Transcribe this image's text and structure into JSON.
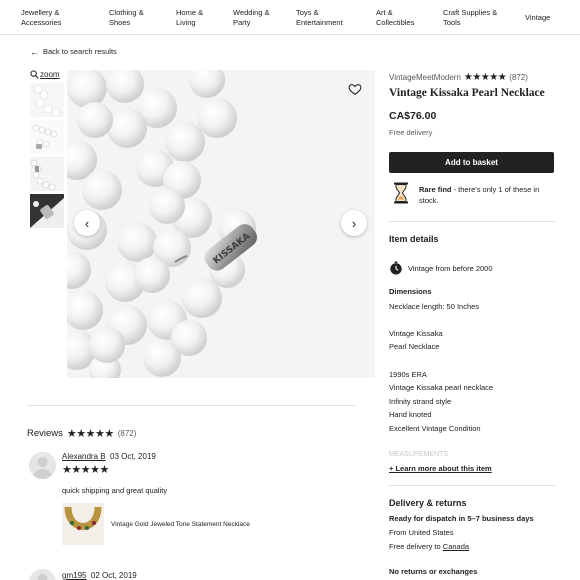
{
  "nav": {
    "categories": [
      "Jewellery & Accessories",
      "Clothing & Shoes",
      "Home & Living",
      "Wedding & Party",
      "Toys & Entertainment",
      "Art & Collectibles",
      "Craft Supplies & Tools",
      "Vintage"
    ]
  },
  "back_link": "Back to search results",
  "gallery": {
    "zoom_label": "zoom"
  },
  "product": {
    "shop_name": "VintageMeetModern",
    "shop_stars": "★★★★★",
    "shop_rating_count": "(872)",
    "title": "Vintage Kissaka Pearl Necklace",
    "price": "CA$76.00",
    "delivery": "Free delivery",
    "add_to_basket": "Add to basket",
    "rare_title": "Rare find",
    "rare_text": " - there's only 1 of these in stock."
  },
  "details": {
    "heading": "Item details",
    "vintage": "Vintage from before 2000",
    "dimensions_label": "Dimensions",
    "dimensions_value": "Necklace length: 50 Inches",
    "desc1": "Vintage Kissaka",
    "desc2": "Pearl Necklace",
    "desc3": "1990s ERA",
    "desc4": "Vintage Kissaka pearl necklace",
    "desc5": "Infinity strand style",
    "desc6": "Hand knoted",
    "desc7": "Excellent Vintage Condition",
    "desc8": "MEASUREMENTS",
    "learn_more": "+ Learn more about this item"
  },
  "delivery_section": {
    "heading": "Delivery & returns",
    "dispatch": "Ready for dispatch in 5–7 business days",
    "from": "From United States",
    "free_to_prefix": "Free delivery to ",
    "free_to_country": "Canada",
    "returns": "No returns or exchanges"
  },
  "reviews": {
    "heading": "Reviews",
    "stars": "★★★★★",
    "count": "(872)",
    "items": [
      {
        "name": "Alexandra B",
        "date": "03 Oct, 2019",
        "stars": "★★★★★",
        "text": "quick shipping and great quality",
        "item_label": "Vintage Gold Jeweled Tone Statement Necklace"
      },
      {
        "name": "gm195",
        "date": "02 Oct, 2019"
      }
    ]
  }
}
